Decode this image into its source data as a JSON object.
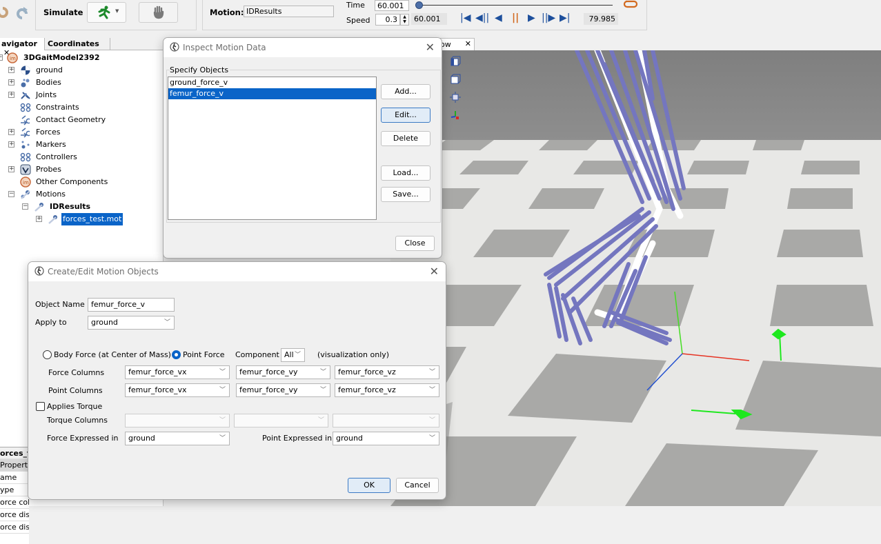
{
  "toolbar": {
    "simulate_label": "Simulate",
    "motion_label": "Motion:",
    "motion_value": "IDResults",
    "time_label": "Time",
    "time_value": "60.001",
    "speed_label": "Speed",
    "speed_value": "0.3",
    "current_time_readout": "60.001",
    "end_time_readout": "79.985",
    "slider_fraction": 0.0,
    "icons": [
      "undo-icon",
      "redo-icon",
      "run-simulation-icon",
      "stop-hand-icon",
      "loop-icon",
      "go-to-start-icon",
      "step-back-icon",
      "play-reverse-icon",
      "pause-icon",
      "play-icon",
      "step-forward-icon",
      "go-to-end-icon"
    ]
  },
  "navigator": {
    "tabs": [
      {
        "label": "avigator"
      },
      {
        "label": "Coordinates"
      }
    ],
    "model_name": "3DGaitModel2392",
    "items": [
      {
        "label": "ground",
        "icon": "ground-icon"
      },
      {
        "label": "Bodies",
        "icon": "bodies-icon"
      },
      {
        "label": "Joints",
        "icon": "joints-icon"
      },
      {
        "label": "Constraints",
        "icon": "constraints-icon"
      },
      {
        "label": "Contact Geometry",
        "icon": "contact-geometry-icon"
      },
      {
        "label": "Forces",
        "icon": "forces-icon"
      },
      {
        "label": "Markers",
        "icon": "markers-icon"
      },
      {
        "label": "Controllers",
        "icon": "controllers-icon"
      },
      {
        "label": "Probes",
        "icon": "probes-icon"
      },
      {
        "label": "Other Components",
        "icon": "other-components-icon"
      },
      {
        "label": "Motions",
        "icon": "motions-icon"
      }
    ],
    "motion_child": "IDResults",
    "motion_grandchild": "forces_test.mot"
  },
  "properties": {
    "title": "orces_t",
    "header": "Properti",
    "rows": [
      "ame",
      "ype",
      "orce colo",
      "orce disp",
      "orce disp"
    ]
  },
  "view3d": {
    "tab_label": "dow",
    "icons": [
      "front-view-icon",
      "perspective-view-icon",
      "fit-view-icon",
      "axes-icon"
    ]
  },
  "inspect_dialog": {
    "title": "Inspect Motion Data",
    "group_label": "Specify Objects",
    "objects": [
      "ground_force_v",
      "femur_force_v"
    ],
    "selected_index": 1,
    "buttons": {
      "add": "Add...",
      "edit": "Edit...",
      "delete": "Delete",
      "load": "Load...",
      "save": "Save...",
      "close": "Close"
    }
  },
  "edit_dialog": {
    "title": "Create/Edit Motion Objects",
    "object_name_label": "Object Name",
    "object_name_value": "femur_force_v",
    "apply_to_label": "Apply to",
    "apply_to_value": "ground",
    "body_force_label": "Body Force (at Center of Mass)",
    "point_force_label": "Point Force",
    "point_force_selected": true,
    "component_label": "Component",
    "component_value": "All",
    "visualization_note": "(visualization only)",
    "force_columns_label": "Force Columns",
    "force_columns": [
      "femur_force_vx",
      "femur_force_vy",
      "femur_force_vz"
    ],
    "point_columns_label": "Point Columns",
    "point_columns": [
      "femur_force_vx",
      "femur_force_vy",
      "femur_force_vz"
    ],
    "applies_torque_label": "Applies Torque",
    "applies_torque_checked": false,
    "torque_columns_label": "Torque Columns",
    "torque_columns": [
      "",
      "",
      ""
    ],
    "force_expressed_label": "Force Expressed in",
    "force_expressed_value": "ground",
    "point_expressed_label": "Point Expressed in",
    "point_expressed_value": "ground",
    "ok_label": "OK",
    "cancel_label": "Cancel"
  }
}
